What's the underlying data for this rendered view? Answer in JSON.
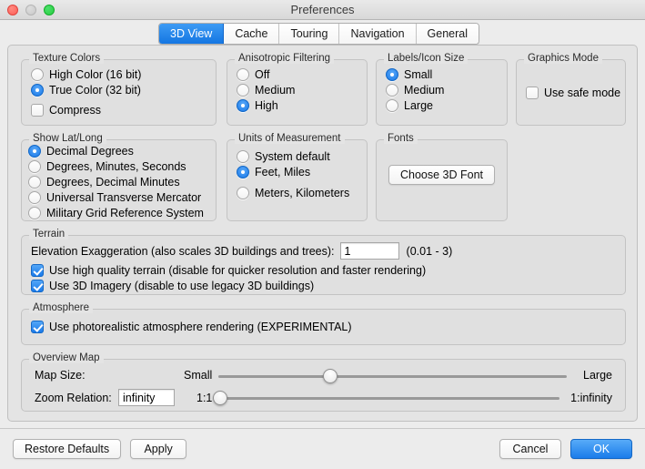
{
  "window": {
    "title": "Preferences",
    "traffic_lights": [
      "close-button",
      "minimize-button",
      "zoom-button"
    ]
  },
  "tabs": [
    {
      "label": "3D View",
      "active": true
    },
    {
      "label": "Cache",
      "active": false
    },
    {
      "label": "Touring",
      "active": false
    },
    {
      "label": "Navigation",
      "active": false
    },
    {
      "label": "General",
      "active": false
    }
  ],
  "texture_colors": {
    "title": "Texture Colors",
    "options": [
      {
        "label": "High Color (16 bit)",
        "selected": false
      },
      {
        "label": "True Color (32 bit)",
        "selected": true
      }
    ],
    "compress": {
      "label": "Compress",
      "checked": false
    }
  },
  "anisotropic_filtering": {
    "title": "Anisotropic Filtering",
    "options": [
      {
        "label": "Off",
        "selected": false
      },
      {
        "label": "Medium",
        "selected": false
      },
      {
        "label": "High",
        "selected": true
      }
    ]
  },
  "labels_icon_size": {
    "title": "Labels/Icon Size",
    "options": [
      {
        "label": "Small",
        "selected": true
      },
      {
        "label": "Medium",
        "selected": false
      },
      {
        "label": "Large",
        "selected": false
      }
    ]
  },
  "graphics_mode": {
    "title": "Graphics Mode",
    "safe_mode": {
      "label": "Use safe mode",
      "checked": false
    }
  },
  "show_lat_long": {
    "title": "Show Lat/Long",
    "options": [
      {
        "label": "Decimal Degrees",
        "selected": true
      },
      {
        "label": "Degrees, Minutes, Seconds",
        "selected": false
      },
      {
        "label": "Degrees, Decimal Minutes",
        "selected": false
      },
      {
        "label": "Universal Transverse Mercator",
        "selected": false
      },
      {
        "label": "Military Grid Reference System",
        "selected": false
      }
    ]
  },
  "units_of_measurement": {
    "title": "Units of Measurement",
    "options": [
      {
        "label": "System default",
        "selected": false
      },
      {
        "label": "Feet, Miles",
        "selected": true
      },
      {
        "label": "Meters, Kilometers",
        "selected": false
      }
    ]
  },
  "fonts": {
    "title": "Fonts",
    "choose_button": "Choose 3D Font"
  },
  "terrain": {
    "title": "Terrain",
    "elevation_label": "Elevation Exaggeration (also scales 3D buildings and trees):",
    "elevation_value": "1",
    "elevation_range": "(0.01 - 3)",
    "high_quality": {
      "label": "Use high quality terrain (disable for quicker resolution and faster rendering)",
      "checked": true
    },
    "imagery_3d": {
      "label": "Use 3D Imagery (disable to use legacy 3D buildings)",
      "checked": true
    }
  },
  "atmosphere": {
    "title": "Atmosphere",
    "photorealistic": {
      "label": "Use photorealistic atmosphere rendering (EXPERIMENTAL)",
      "checked": true
    }
  },
  "overview_map": {
    "title": "Overview Map",
    "map_size": {
      "label": "Map Size:",
      "min_label": "Small",
      "max_label": "Large",
      "percent": 32
    },
    "zoom_relation": {
      "label": "Zoom Relation:",
      "value": "infinity",
      "min_label": "1:1",
      "max_label": "1:infinity",
      "percent": 0
    }
  },
  "footer": {
    "restore_defaults": "Restore Defaults",
    "apply": "Apply",
    "cancel": "Cancel",
    "ok": "OK"
  },
  "colors": {
    "accent": "#1a7cea",
    "window_bg": "#ececec",
    "panel_bg": "#e4e4e4",
    "group_bg": "#e0e0e0"
  }
}
